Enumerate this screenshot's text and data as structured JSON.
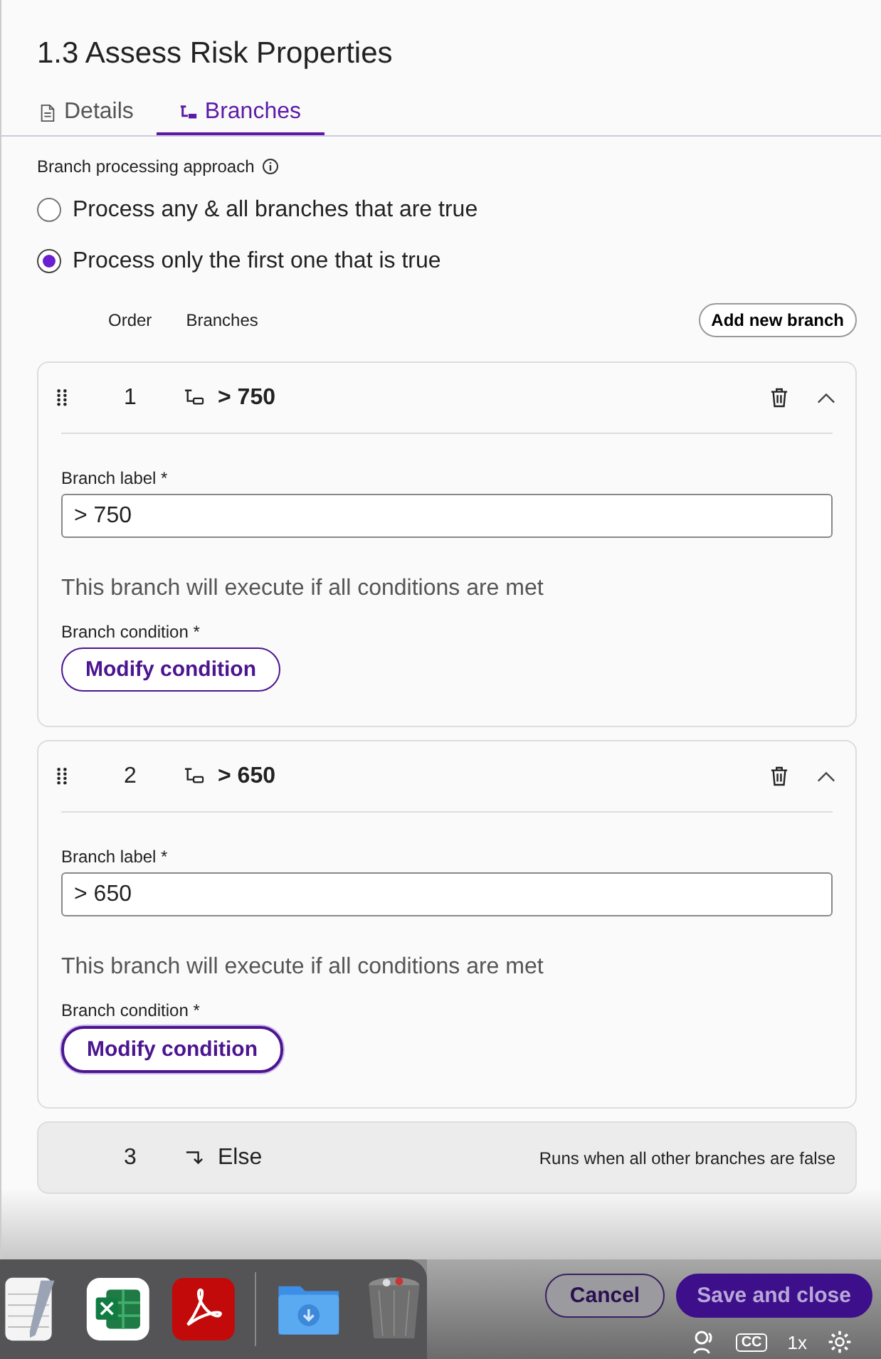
{
  "dialog": {
    "title": "1.3 Assess Risk Properties"
  },
  "tabs": [
    {
      "label": "Details",
      "selected": false,
      "kind": "doc"
    },
    {
      "label": "Branches",
      "selected": true,
      "kind": "branch"
    }
  ],
  "approach": {
    "label": "Branch processing approach",
    "options": [
      {
        "label": "Process any & all branches that are true",
        "selected": false
      },
      {
        "label": "Process only the first one that is true",
        "selected": true
      }
    ]
  },
  "columns": [
    "Order",
    "Branches"
  ],
  "add_button": "Add new branch",
  "branches": [
    {
      "order": "1",
      "title": "> 750",
      "kind": "condition",
      "expanded": true,
      "field_label": "Branch label",
      "required_mark": "*",
      "value": "> 750",
      "note": "This branch will execute if all conditions are met",
      "condition_label": "Branch condition",
      "condition_mark": "*",
      "button": "Modify condition",
      "focused": false
    },
    {
      "order": "2",
      "title": "> 650",
      "kind": "condition",
      "expanded": true,
      "field_label": "Branch label",
      "required_mark": "*",
      "value": "> 650",
      "note": "This branch will execute if all conditions are met",
      "condition_label": "Branch condition",
      "condition_mark": "*",
      "button": "Modify condition",
      "focused": true
    },
    {
      "order": "3",
      "title": "Else",
      "kind": "else",
      "description": "Runs when all other branches are false"
    }
  ],
  "footer": {
    "buttons": [
      {
        "label": "Cancel",
        "kind": "secondary"
      },
      {
        "label": "Save and close",
        "kind": "primary"
      }
    ]
  },
  "player": {
    "cc": "CC",
    "speed": "1x"
  }
}
